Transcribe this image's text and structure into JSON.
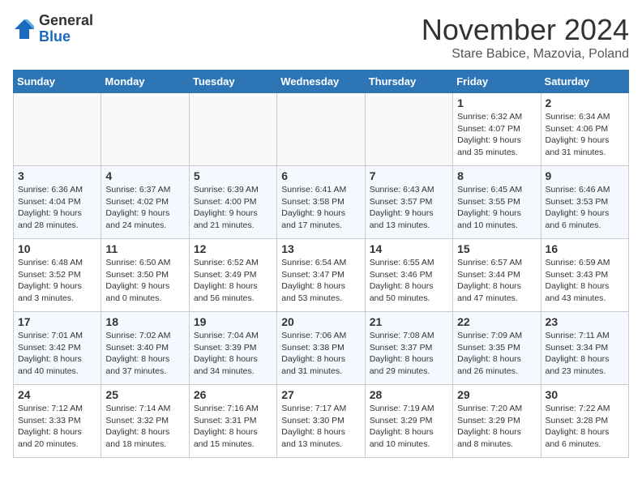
{
  "logo": {
    "general": "General",
    "blue": "Blue"
  },
  "title": "November 2024",
  "subtitle": "Stare Babice, Mazovia, Poland",
  "headers": [
    "Sunday",
    "Monday",
    "Tuesday",
    "Wednesday",
    "Thursday",
    "Friday",
    "Saturday"
  ],
  "weeks": [
    [
      {
        "day": "",
        "info": ""
      },
      {
        "day": "",
        "info": ""
      },
      {
        "day": "",
        "info": ""
      },
      {
        "day": "",
        "info": ""
      },
      {
        "day": "",
        "info": ""
      },
      {
        "day": "1",
        "info": "Sunrise: 6:32 AM\nSunset: 4:07 PM\nDaylight: 9 hours\nand 35 minutes."
      },
      {
        "day": "2",
        "info": "Sunrise: 6:34 AM\nSunset: 4:06 PM\nDaylight: 9 hours\nand 31 minutes."
      }
    ],
    [
      {
        "day": "3",
        "info": "Sunrise: 6:36 AM\nSunset: 4:04 PM\nDaylight: 9 hours\nand 28 minutes."
      },
      {
        "day": "4",
        "info": "Sunrise: 6:37 AM\nSunset: 4:02 PM\nDaylight: 9 hours\nand 24 minutes."
      },
      {
        "day": "5",
        "info": "Sunrise: 6:39 AM\nSunset: 4:00 PM\nDaylight: 9 hours\nand 21 minutes."
      },
      {
        "day": "6",
        "info": "Sunrise: 6:41 AM\nSunset: 3:58 PM\nDaylight: 9 hours\nand 17 minutes."
      },
      {
        "day": "7",
        "info": "Sunrise: 6:43 AM\nSunset: 3:57 PM\nDaylight: 9 hours\nand 13 minutes."
      },
      {
        "day": "8",
        "info": "Sunrise: 6:45 AM\nSunset: 3:55 PM\nDaylight: 9 hours\nand 10 minutes."
      },
      {
        "day": "9",
        "info": "Sunrise: 6:46 AM\nSunset: 3:53 PM\nDaylight: 9 hours\nand 6 minutes."
      }
    ],
    [
      {
        "day": "10",
        "info": "Sunrise: 6:48 AM\nSunset: 3:52 PM\nDaylight: 9 hours\nand 3 minutes."
      },
      {
        "day": "11",
        "info": "Sunrise: 6:50 AM\nSunset: 3:50 PM\nDaylight: 9 hours\nand 0 minutes."
      },
      {
        "day": "12",
        "info": "Sunrise: 6:52 AM\nSunset: 3:49 PM\nDaylight: 8 hours\nand 56 minutes."
      },
      {
        "day": "13",
        "info": "Sunrise: 6:54 AM\nSunset: 3:47 PM\nDaylight: 8 hours\nand 53 minutes."
      },
      {
        "day": "14",
        "info": "Sunrise: 6:55 AM\nSunset: 3:46 PM\nDaylight: 8 hours\nand 50 minutes."
      },
      {
        "day": "15",
        "info": "Sunrise: 6:57 AM\nSunset: 3:44 PM\nDaylight: 8 hours\nand 47 minutes."
      },
      {
        "day": "16",
        "info": "Sunrise: 6:59 AM\nSunset: 3:43 PM\nDaylight: 8 hours\nand 43 minutes."
      }
    ],
    [
      {
        "day": "17",
        "info": "Sunrise: 7:01 AM\nSunset: 3:42 PM\nDaylight: 8 hours\nand 40 minutes."
      },
      {
        "day": "18",
        "info": "Sunrise: 7:02 AM\nSunset: 3:40 PM\nDaylight: 8 hours\nand 37 minutes."
      },
      {
        "day": "19",
        "info": "Sunrise: 7:04 AM\nSunset: 3:39 PM\nDaylight: 8 hours\nand 34 minutes."
      },
      {
        "day": "20",
        "info": "Sunrise: 7:06 AM\nSunset: 3:38 PM\nDaylight: 8 hours\nand 31 minutes."
      },
      {
        "day": "21",
        "info": "Sunrise: 7:08 AM\nSunset: 3:37 PM\nDaylight: 8 hours\nand 29 minutes."
      },
      {
        "day": "22",
        "info": "Sunrise: 7:09 AM\nSunset: 3:35 PM\nDaylight: 8 hours\nand 26 minutes."
      },
      {
        "day": "23",
        "info": "Sunrise: 7:11 AM\nSunset: 3:34 PM\nDaylight: 8 hours\nand 23 minutes."
      }
    ],
    [
      {
        "day": "24",
        "info": "Sunrise: 7:12 AM\nSunset: 3:33 PM\nDaylight: 8 hours\nand 20 minutes."
      },
      {
        "day": "25",
        "info": "Sunrise: 7:14 AM\nSunset: 3:32 PM\nDaylight: 8 hours\nand 18 minutes."
      },
      {
        "day": "26",
        "info": "Sunrise: 7:16 AM\nSunset: 3:31 PM\nDaylight: 8 hours\nand 15 minutes."
      },
      {
        "day": "27",
        "info": "Sunrise: 7:17 AM\nSunset: 3:30 PM\nDaylight: 8 hours\nand 13 minutes."
      },
      {
        "day": "28",
        "info": "Sunrise: 7:19 AM\nSunset: 3:29 PM\nDaylight: 8 hours\nand 10 minutes."
      },
      {
        "day": "29",
        "info": "Sunrise: 7:20 AM\nSunset: 3:29 PM\nDaylight: 8 hours\nand 8 minutes."
      },
      {
        "day": "30",
        "info": "Sunrise: 7:22 AM\nSunset: 3:28 PM\nDaylight: 8 hours\nand 6 minutes."
      }
    ]
  ]
}
